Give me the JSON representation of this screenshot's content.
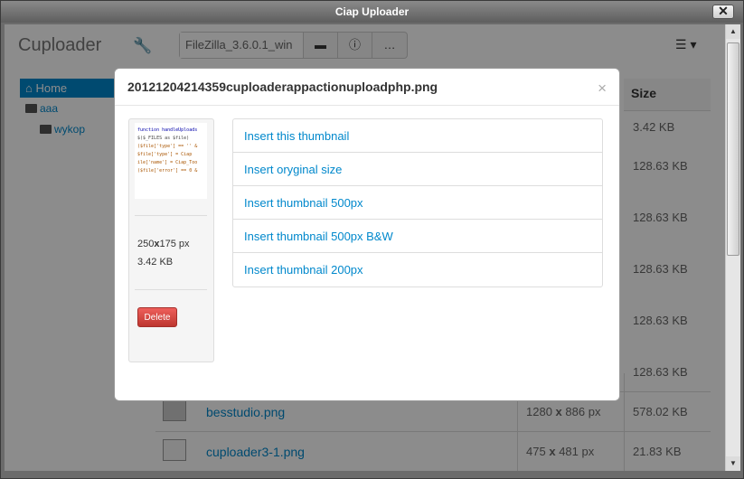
{
  "window": {
    "title": "Ciap Uploader",
    "close_glyph": "✕"
  },
  "app": {
    "brand": "Cuploader",
    "toolbar": {
      "input_value": "FileZilla_3.6.0.1_win",
      "button2": "…"
    },
    "sidebar": {
      "home": "Home",
      "folders": [
        {
          "label": "aaa"
        },
        {
          "label": "wykop"
        }
      ]
    },
    "table": {
      "size_header": "Size",
      "sizes": [
        "3.42 KB",
        "128.63 KB",
        "128.63 KB",
        "128.63 KB",
        "128.63 KB",
        "128.63 KB"
      ],
      "rows": [
        {
          "name": "besstudio.png",
          "dims_w": "1280",
          "dims_h": "886 px",
          "size": "578.02 KB"
        },
        {
          "name": "cuploader3-1.png",
          "dims_w": "475",
          "dims_h": "481 px",
          "size": "21.83 KB"
        }
      ]
    }
  },
  "modal": {
    "title": "20121204214359cuploaderappactionuploadphp.png",
    "close_glyph": "×",
    "preview": {
      "code_lines": [
        "function handleUploads",
        "$($_FILES as $file)",
        "($file['type'] == '' &",
        "  $file['type'] = Ciap",
        "ile['name'] = Ciap_Too",
        "($file['error'] == 0 &"
      ],
      "width": "250",
      "height": "175 px",
      "size": "3.42 KB",
      "delete_label": "Delete"
    },
    "options": [
      "Insert this thumbnail",
      "Insert oryginal size",
      "Insert thumbnail 500px",
      "Insert thumbnail 500px B&W",
      "Insert thumbnail 200px"
    ]
  },
  "colors": {
    "accent": "#0088cc",
    "danger": "#da4f49",
    "overlay": "rgba(0,0,0,0.45)"
  }
}
